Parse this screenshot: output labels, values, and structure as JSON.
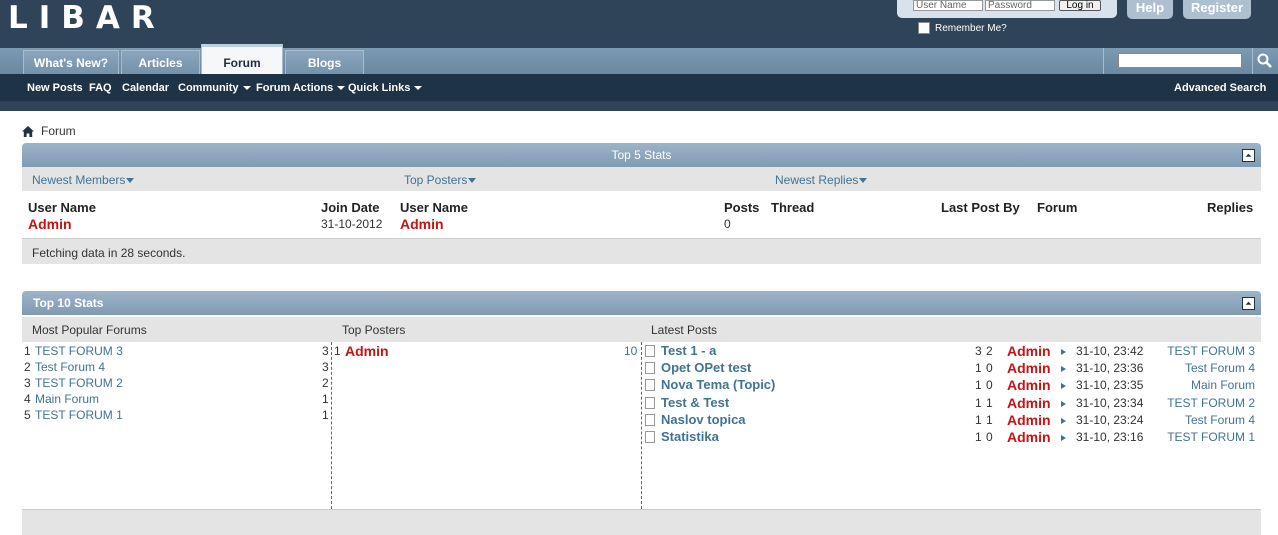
{
  "header": {
    "logo": "LIBAR",
    "login": {
      "username_placeholder": "User Name",
      "password_placeholder": "Password",
      "login_label": "Log in",
      "remember_label": "Remember Me?"
    },
    "help_label": "Help",
    "register_label": "Register"
  },
  "tabs": [
    {
      "label": "What's New?"
    },
    {
      "label": "Articles"
    },
    {
      "label": "Forum"
    },
    {
      "label": "Blogs"
    }
  ],
  "subnav": {
    "items": [
      "New Posts",
      "FAQ",
      "Calendar",
      "Community",
      "Forum Actions",
      "Quick Links"
    ],
    "advanced_search": "Advanced Search"
  },
  "breadcrumb": "Forum",
  "top5": {
    "title": "Top 5 Stats",
    "tabs": [
      "Newest Members",
      "Top Posters",
      "Newest Replies"
    ],
    "headers": {
      "user_name_1": "User Name",
      "join_date": "Join Date",
      "user_name_2": "User Name",
      "posts": "Posts",
      "thread": "Thread",
      "last_post_by": "Last Post By",
      "forum": "Forum",
      "replies": "Replies"
    },
    "row": {
      "member": "Admin",
      "join_date": "31-10-2012",
      "poster": "Admin",
      "posts": "0"
    },
    "footer": "Fetching data in 28 seconds."
  },
  "top10": {
    "title": "Top 10 Stats",
    "columns": [
      "Most Popular Forums",
      "Top Posters",
      "Latest Posts"
    ],
    "forums": [
      {
        "rank": "1",
        "name": "TEST FORUM 3",
        "count": "3"
      },
      {
        "rank": "2",
        "name": "Test Forum 4",
        "count": "3"
      },
      {
        "rank": "3",
        "name": "TEST FORUM 2",
        "count": "2"
      },
      {
        "rank": "4",
        "name": "Main Forum",
        "count": "1"
      },
      {
        "rank": "5",
        "name": "TEST FORUM 1",
        "count": "1"
      }
    ],
    "posters": [
      {
        "rank": "1",
        "name": "Admin",
        "count": "10"
      }
    ],
    "posts": [
      {
        "title": "Test 1 - a",
        "replies": "3",
        "views": "2",
        "user": "Admin",
        "time": "31-10, 23:42",
        "forum": "TEST FORUM 3"
      },
      {
        "title": "Opet OPet test",
        "replies": "1",
        "views": "0",
        "user": "Admin",
        "time": "31-10, 23:36",
        "forum": "Test Forum 4"
      },
      {
        "title": "Nova Tema (Topic)",
        "replies": "1",
        "views": "0",
        "user": "Admin",
        "time": "31-10, 23:35",
        "forum": "Main Forum"
      },
      {
        "title": "Test & Test",
        "replies": "1",
        "views": "1",
        "user": "Admin",
        "time": "31-10, 23:34",
        "forum": "TEST FORUM 2"
      },
      {
        "title": "Naslov topica",
        "replies": "1",
        "views": "1",
        "user": "Admin",
        "time": "31-10, 23:24",
        "forum": "Test Forum 4"
      },
      {
        "title": "Statistika",
        "replies": "1",
        "views": "0",
        "user": "Admin",
        "time": "31-10, 23:16",
        "forum": "TEST FORUM 1"
      }
    ]
  }
}
